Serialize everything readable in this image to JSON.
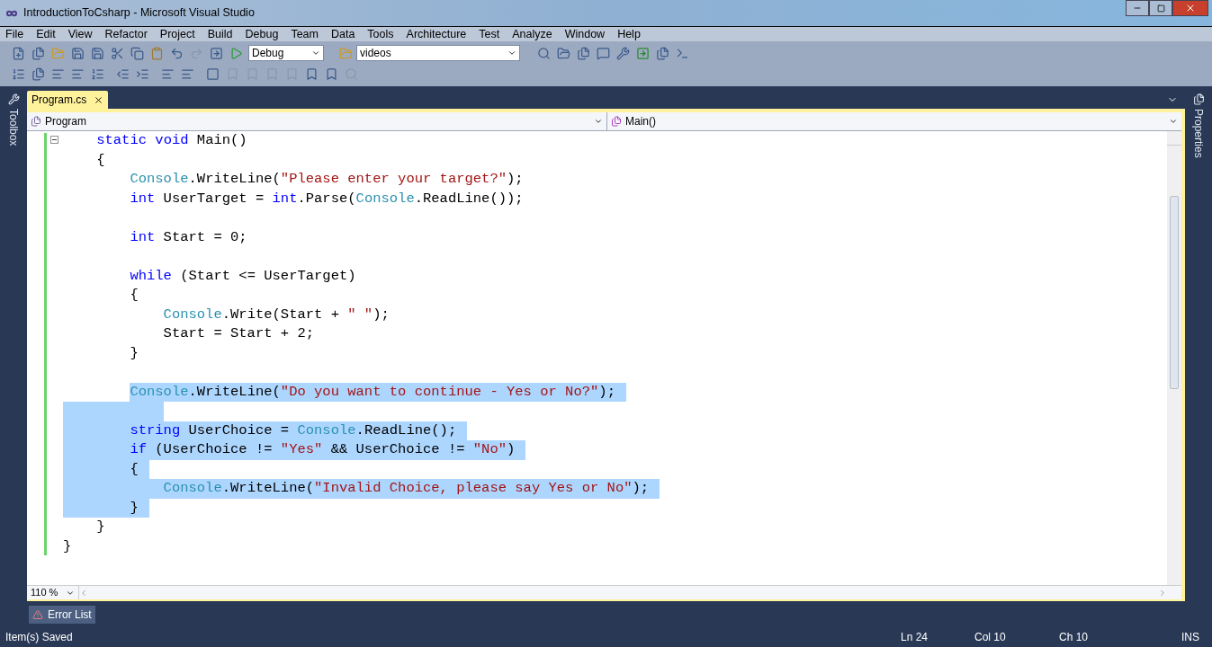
{
  "window": {
    "title": "IntroductionToCsharp - Microsoft Visual Studio"
  },
  "menu": [
    "File",
    "Edit",
    "View",
    "Refactor",
    "Project",
    "Build",
    "Debug",
    "Team",
    "Data",
    "Tools",
    "Architecture",
    "Test",
    "Analyze",
    "Window",
    "Help"
  ],
  "toolbar": {
    "configuration": "Debug",
    "find": "videos"
  },
  "side_panels": {
    "left": "Toolbox",
    "right": "Properties"
  },
  "tabs": [
    {
      "label": "Program.cs",
      "selected": true
    }
  ],
  "navigation": {
    "type": "Program",
    "member": "Main()"
  },
  "code": [
    {
      "children": [
        {
          "selected": false,
          "tokens": [
            {
              "kind": "keyword",
              "text": "static"
            },
            {
              "kind": "space"
            },
            {
              "kind": "keyword",
              "text": "void"
            },
            {
              "kind": "plain",
              "text": " Main()"
            }
          ]
        },
        {
          "selected": false,
          "tokens": [
            {
              "kind": "plain",
              "text": "{"
            }
          ]
        },
        {
          "children": [
            {
              "selected": false,
              "tokens": [
                {
                  "kind": "type",
                  "text": "Console"
                },
                {
                  "kind": "plain",
                  "text": ".WriteLine("
                },
                {
                  "kind": "string",
                  "text": "\"Please enter your target?\""
                },
                {
                  "kind": "plain",
                  "text": ");"
                }
              ]
            },
            {
              "selected": false,
              "tokens": [
                {
                  "kind": "keyword",
                  "text": "int"
                },
                {
                  "kind": "plain",
                  "text": " UserTarget = "
                },
                {
                  "kind": "keyword",
                  "text": "int"
                },
                {
                  "kind": "plain",
                  "text": ".Parse("
                },
                {
                  "kind": "type",
                  "text": "Console"
                },
                {
                  "kind": "plain",
                  "text": ".ReadLine());"
                }
              ]
            },
            {
              "selected": false
            },
            {
              "selected": false,
              "tokens": [
                {
                  "kind": "keyword",
                  "text": "int"
                },
                {
                  "kind": "plain",
                  "text": " Start = 0;"
                }
              ]
            },
            {
              "selected": false
            },
            {
              "selected": false,
              "tokens": [
                {
                  "kind": "keyword",
                  "text": "while"
                },
                {
                  "kind": "plain",
                  "text": " (Start <= UserTarget)"
                }
              ]
            },
            {
              "selected": false,
              "tokens": [
                {
                  "kind": "plain",
                  "text": "{"
                }
              ]
            },
            {
              "children": [
                {
                  "selected": false,
                  "tokens": [
                    {
                      "kind": "type",
                      "text": "Console"
                    },
                    {
                      "kind": "plain",
                      "text": ".Write(Start + "
                    },
                    {
                      "kind": "string",
                      "text": "\" \""
                    },
                    {
                      "kind": "plain",
                      "text": ");"
                    }
                  ]
                },
                {
                  "selected": false,
                  "tokens": [
                    {
                      "kind": "plain",
                      "text": "Start = Start + 2;"
                    }
                  ]
                }
              ]
            },
            {
              "selected": false,
              "tokens": [
                {
                  "kind": "plain",
                  "text": "}"
                }
              ]
            },
            {
              "selected": false
            },
            {
              "selected": true,
              "tokens": [
                {
                  "kind": "type",
                  "text": "Console"
                },
                {
                  "kind": "plain",
                  "text": ".WriteLine("
                },
                {
                  "kind": "string",
                  "text": "\"Do you want to continue - Yes or No?\""
                },
                {
                  "kind": "plain",
                  "text": ");"
                }
              ]
            },
            {
              "selected": true
            },
            {
              "selected": true,
              "tokens": [
                {
                  "kind": "keyword",
                  "text": "string"
                },
                {
                  "kind": "plain",
                  "text": " UserChoice = "
                },
                {
                  "kind": "type",
                  "text": "Console"
                },
                {
                  "kind": "plain",
                  "text": ".ReadLine();"
                }
              ]
            },
            {
              "selected": true,
              "tokens": [
                {
                  "kind": "keyword",
                  "text": "if"
                },
                {
                  "kind": "plain",
                  "text": " (UserChoice != "
                },
                {
                  "kind": "string",
                  "text": "\"Yes\""
                },
                {
                  "kind": "plain",
                  "text": " && UserChoice != "
                },
                {
                  "kind": "string",
                  "text": "\"No\""
                },
                {
                  "kind": "plain",
                  "text": ")"
                }
              ]
            },
            {
              "selected": true,
              "tokens": [
                {
                  "kind": "plain",
                  "text": "{"
                }
              ]
            },
            {
              "children": [
                {
                  "selected": true,
                  "tokens": [
                    {
                      "kind": "type",
                      "text": "Console"
                    },
                    {
                      "kind": "plain",
                      "text": ".WriteLine("
                    },
                    {
                      "kind": "string",
                      "text": "\"Invalid Choice, please say Yes or No\""
                    },
                    {
                      "kind": "plain",
                      "text": ");"
                    }
                  ]
                }
              ]
            },
            {
              "selected": true,
              "tokens": [
                {
                  "kind": "plain",
                  "text": "}"
                }
              ]
            }
          ]
        },
        {
          "selected": false,
          "tokens": [
            {
              "kind": "plain",
              "text": "}"
            }
          ]
        }
      ]
    },
    {
      "selected": false,
      "tokens": [
        {
          "kind": "plain",
          "text": "}"
        }
      ]
    }
  ],
  "zoom": "110 %",
  "bottom_tabs": [
    "Error List"
  ],
  "status_bar": {
    "message": "Item(s) Saved",
    "line": "Ln 24",
    "column": "Col 10",
    "char": "Ch 10",
    "mode": "INS"
  }
}
